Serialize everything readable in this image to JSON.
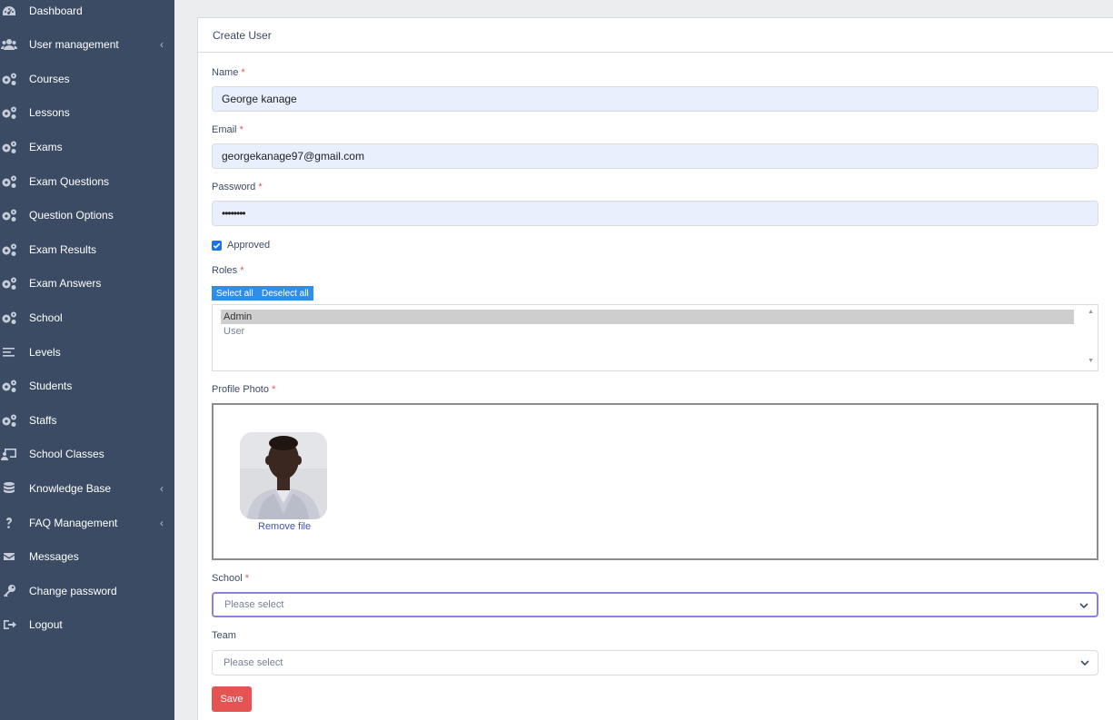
{
  "sidebar": {
    "items": [
      {
        "label": "Dashboard",
        "icon": "speedometer-icon",
        "has_children": false
      },
      {
        "label": "User management",
        "icon": "users-icon",
        "has_children": true
      },
      {
        "label": "Courses",
        "icon": "gears-icon",
        "has_children": false
      },
      {
        "label": "Lessons",
        "icon": "gears-icon",
        "has_children": false
      },
      {
        "label": "Exams",
        "icon": "gears-icon",
        "has_children": false
      },
      {
        "label": "Exam Questions",
        "icon": "gears-icon",
        "has_children": false
      },
      {
        "label": "Question Options",
        "icon": "gears-icon",
        "has_children": false
      },
      {
        "label": "Exam Results",
        "icon": "gears-icon",
        "has_children": false
      },
      {
        "label": "Exam Answers",
        "icon": "gears-icon",
        "has_children": false
      },
      {
        "label": "School",
        "icon": "gears-icon",
        "has_children": false
      },
      {
        "label": "Levels",
        "icon": "list-icon",
        "has_children": false
      },
      {
        "label": "Students",
        "icon": "gears-icon",
        "has_children": false
      },
      {
        "label": "Staffs",
        "icon": "gears-icon",
        "has_children": false
      },
      {
        "label": "School Classes",
        "icon": "chalkboard-icon",
        "has_children": false
      },
      {
        "label": "Knowledge Base",
        "icon": "database-icon",
        "has_children": true
      },
      {
        "label": "FAQ Management",
        "icon": "question-icon",
        "has_children": true
      },
      {
        "label": "Messages",
        "icon": "envelope-icon",
        "has_children": false
      },
      {
        "label": "Change password",
        "icon": "key-icon",
        "has_children": false
      },
      {
        "label": "Logout",
        "icon": "logout-icon",
        "has_children": false
      }
    ],
    "chevron": "‹"
  },
  "form": {
    "title": "Create User",
    "required_mark": "*",
    "name": {
      "label": "Name",
      "value": "George kanage"
    },
    "email": {
      "label": "Email",
      "value": "georgekanage97@gmail.com"
    },
    "password": {
      "label": "Password",
      "value": "••••••••"
    },
    "approved": {
      "label": "Approved",
      "checked": true
    },
    "roles": {
      "label": "Roles",
      "select_all": "Select all",
      "deselect_all": "Deselect all",
      "options": [
        {
          "label": "Admin",
          "selected": true
        },
        {
          "label": "User",
          "selected": false
        }
      ]
    },
    "profile_photo": {
      "label": "Profile Photo",
      "remove_label": "Remove file"
    },
    "school": {
      "label": "School",
      "placeholder": "Please select"
    },
    "team": {
      "label": "Team",
      "placeholder": "Please select"
    },
    "save_label": "Save"
  },
  "colors": {
    "sidebar_bg": "#3c4b64",
    "required": "#e55353",
    "save_button": "#e55353",
    "select_buttons": "#2f8fe8",
    "autofill_bg": "#e8f0fe",
    "focus_border": "#8a82e0"
  }
}
